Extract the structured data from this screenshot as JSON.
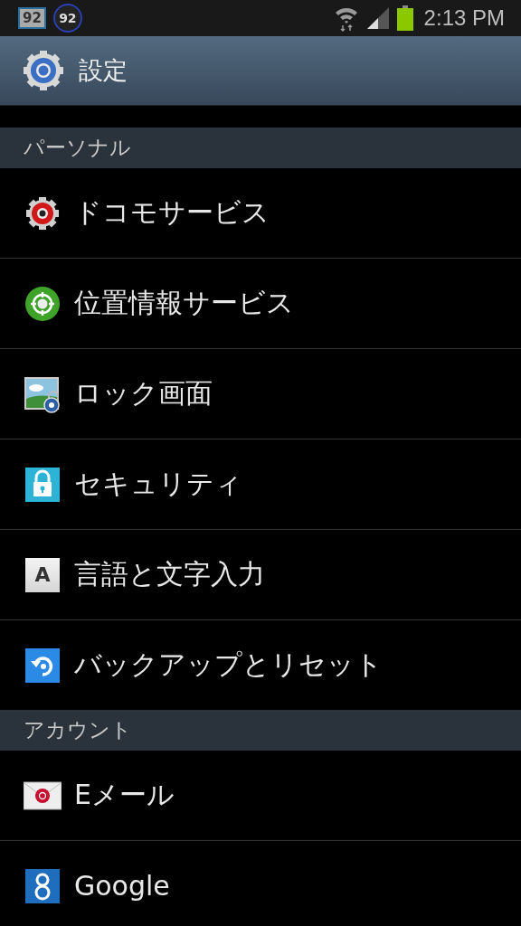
{
  "status_bar": {
    "notifications": [
      {
        "kind": "battery-badge",
        "text": "92"
      },
      {
        "kind": "ring-badge",
        "text": "92"
      }
    ],
    "time": "2:13 PM"
  },
  "action_bar": {
    "title": "設定"
  },
  "sections": [
    {
      "header": "パーソナル",
      "items": [
        {
          "label": "ドコモサービス",
          "kind": "gear"
        },
        {
          "label": "位置情報サービス",
          "kind": "location"
        },
        {
          "label": "ロック画面",
          "kind": "lockscreen"
        },
        {
          "label": "セキュリティ",
          "kind": "security"
        },
        {
          "label": "言語と文字入力",
          "kind": "language",
          "icon_text": "A"
        },
        {
          "label": "バックアップとリセット",
          "kind": "backup"
        }
      ]
    },
    {
      "header": "アカウント",
      "items": [
        {
          "label": "Eメール",
          "kind": "email"
        },
        {
          "label": "Google",
          "kind": "account"
        }
      ]
    }
  ]
}
